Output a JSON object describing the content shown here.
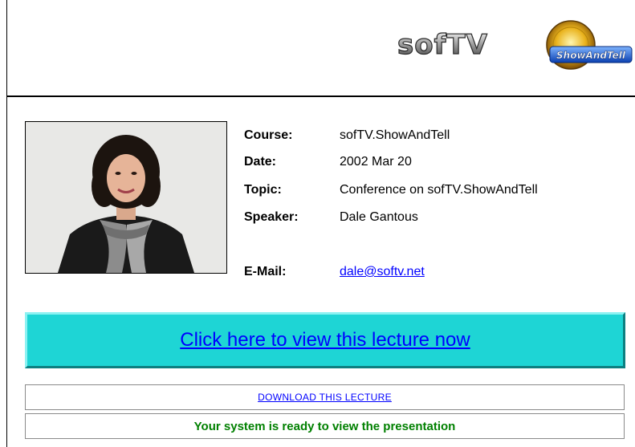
{
  "logo": {
    "brand_text": "sofTV",
    "badge_text": "ShowAndTell"
  },
  "info": {
    "course_label": "Course:",
    "course_value": "sofTV.ShowAndTell",
    "date_label": "Date:",
    "date_value": "2002 Mar 20",
    "topic_label": "Topic:",
    "topic_value": "Conference on sofTV.ShowAndTell",
    "speaker_label": "Speaker:",
    "speaker_value": "Dale Gantous",
    "email_label": "E-Mail:",
    "email_value": "dale@softv.net"
  },
  "actions": {
    "view_lecture_label": "Click here to view this lecture now",
    "download_label": "DOWNLOAD THIS LECTURE",
    "status_text": "Your system is ready to view the presentation"
  },
  "colors": {
    "button_bg": "#1ed5d5",
    "link": "#0000ff",
    "status_green": "#008000"
  }
}
